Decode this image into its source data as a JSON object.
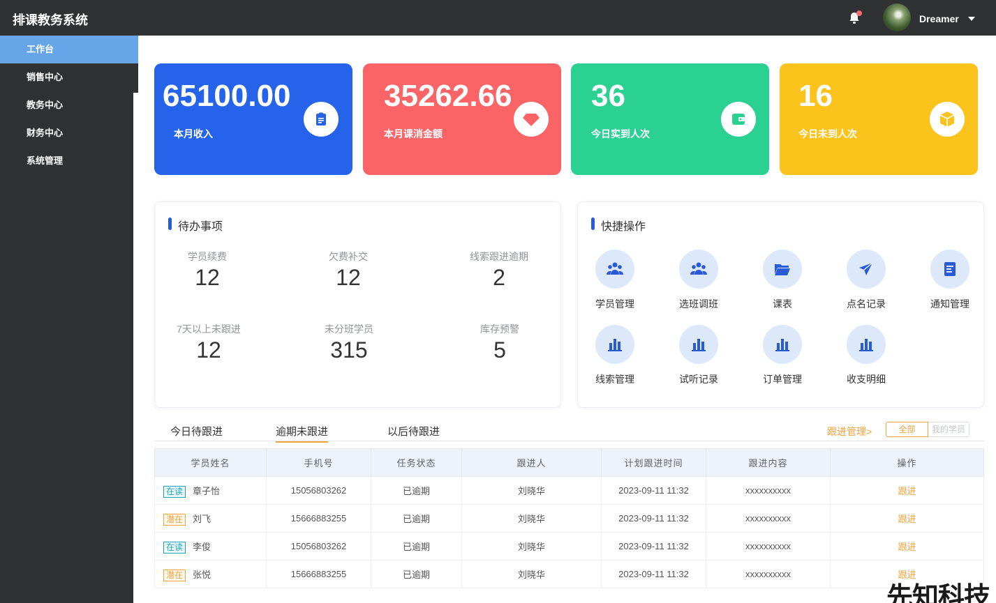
{
  "app": {
    "title": "排课教务系统"
  },
  "header": {
    "username": "Dreamer"
  },
  "sidebar": {
    "items": [
      {
        "label": "工作台",
        "active": true
      },
      {
        "label": "销售中心"
      },
      {
        "label": "教务中心"
      },
      {
        "label": "财务中心"
      },
      {
        "label": "系统管理"
      }
    ]
  },
  "stats": [
    {
      "value": "65100.00",
      "label": "本月收入",
      "color": "#2563eb",
      "icon": "clipboard-icon"
    },
    {
      "value": "35262.66",
      "label": "本月课消金额",
      "color": "#fb6467",
      "icon": "diamond-icon"
    },
    {
      "value": "36",
      "label": "今日实到人次",
      "color": "#2bd093",
      "icon": "wallet-icon"
    },
    {
      "value": "16",
      "label": "今日未到人次",
      "color": "#fdc31d",
      "icon": "box-icon"
    }
  ],
  "todo": {
    "title": "待办事项",
    "items": [
      {
        "label": "学员续费",
        "value": "12"
      },
      {
        "label": "欠费补交",
        "value": "12"
      },
      {
        "label": "线索跟进逾期",
        "value": "2"
      },
      {
        "label": "7天以上未跟进",
        "value": "12"
      },
      {
        "label": "未分班学员",
        "value": "315"
      },
      {
        "label": "库存预警",
        "value": "5"
      }
    ]
  },
  "quick": {
    "title": "快捷操作",
    "items": [
      {
        "label": "学员管理",
        "icon": "users-icon"
      },
      {
        "label": "选班调班",
        "icon": "users-icon"
      },
      {
        "label": "课表",
        "icon": "folder-icon"
      },
      {
        "label": "点名记录",
        "icon": "send-icon"
      },
      {
        "label": "通知管理",
        "icon": "document-icon"
      },
      {
        "label": "线索管理",
        "icon": "bar-chart-icon"
      },
      {
        "label": "试听记录",
        "icon": "bar-chart-icon"
      },
      {
        "label": "订单管理",
        "icon": "bar-chart-icon"
      },
      {
        "label": "收支明细",
        "icon": "bar-chart-icon"
      }
    ]
  },
  "followup": {
    "tabs": [
      "今日待跟进",
      "逾期未跟进",
      "以后待跟进"
    ],
    "active_tab": 1,
    "manage_link": "跟进管理>",
    "filter": {
      "all": "全部",
      "mine": "我的学员"
    },
    "columns": [
      "学员姓名",
      "手机号",
      "任务状态",
      "跟进人",
      "计划跟进时间",
      "跟进内容",
      "操作"
    ],
    "rows": [
      {
        "tag": "在读",
        "tag_type": "reading",
        "name": "章子怡",
        "phone": "15056803262",
        "status": "已逾期",
        "owner": "刘晓华",
        "time": "2023-09-11 11:32",
        "content": "xxxxxxxxxx",
        "action": "跟进"
      },
      {
        "tag": "潜在",
        "tag_type": "potential",
        "name": "刘飞",
        "phone": "15666883255",
        "status": "已逾期",
        "owner": "刘晓华",
        "time": "2023-09-11 11:32",
        "content": "xxxxxxxxxx",
        "action": "跟进"
      },
      {
        "tag": "在读",
        "tag_type": "reading",
        "name": "李俊",
        "phone": "15056803262",
        "status": "已逾期",
        "owner": "刘晓华",
        "time": "2023-09-11 11:32",
        "content": "xxxxxxxxxx",
        "action": "跟进"
      },
      {
        "tag": "潜在",
        "tag_type": "potential",
        "name": "张悦",
        "phone": "15666883255",
        "status": "已逾期",
        "owner": "刘晓华",
        "time": "2023-09-11 11:32",
        "content": "xxxxxxxxxx",
        "action": "跟进"
      }
    ]
  },
  "watermark": "先知科技"
}
